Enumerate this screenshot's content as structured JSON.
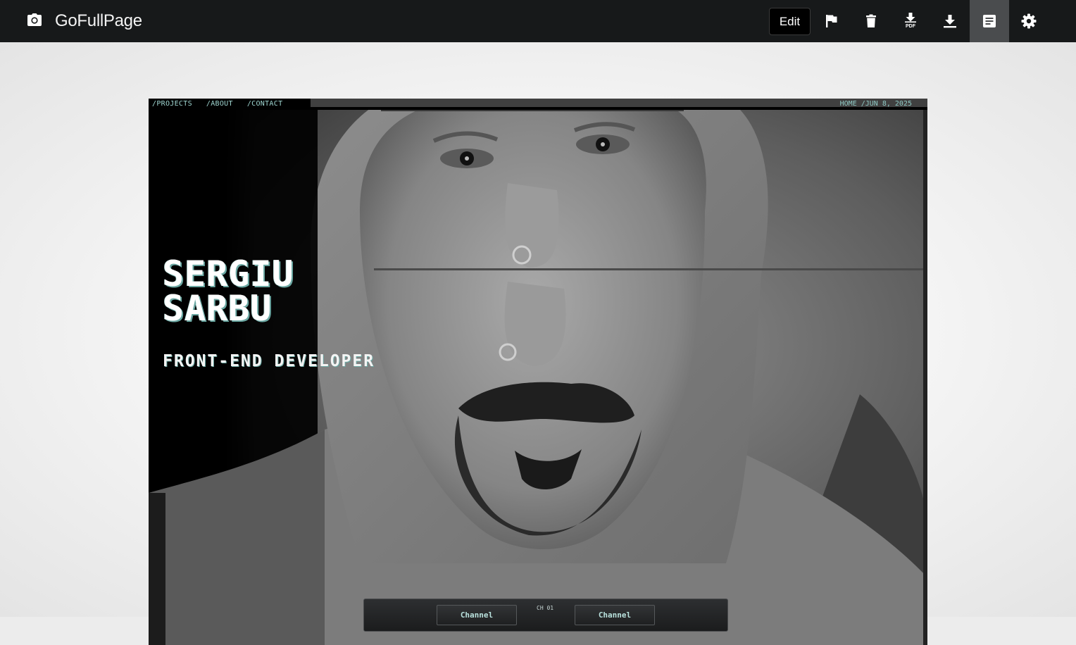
{
  "toolbar": {
    "app_title": "GoFullPage",
    "edit_label": "Edit",
    "icons": [
      "camera-icon",
      "flag-icon",
      "trash-icon",
      "download-pdf-icon",
      "download-icon",
      "notes-icon",
      "gear-icon"
    ],
    "pdf_badge": "PDF"
  },
  "page": {
    "nav": {
      "projects": "/PROJECTS",
      "about": "/ABOUT",
      "contact": "/CONTACT"
    },
    "date": "HOME /JUN 8, 2025",
    "name_line1": "SERGIU",
    "name_line2": "SARBU",
    "role": "FRONT-END DEVELOPER",
    "controls": {
      "channel_left": "Channel",
      "channel_label": "CH 01",
      "channel_right": "Channel"
    },
    "accent_color": "#9fd6d1"
  }
}
